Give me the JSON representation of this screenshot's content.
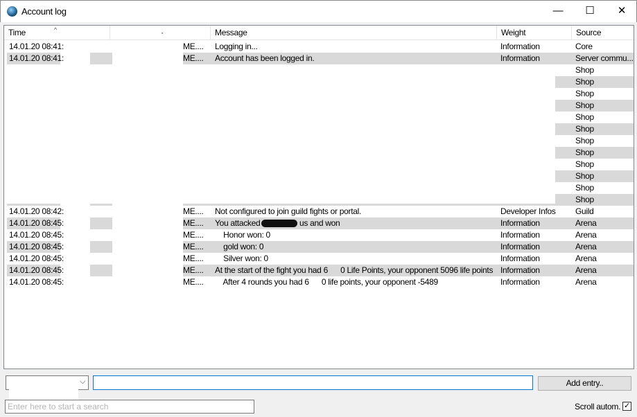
{
  "window": {
    "title": "Account log",
    "minimize": "—",
    "maximize": "☐",
    "close": "✕"
  },
  "columns": {
    "time": "Time",
    "col2": "·",
    "message": "Message",
    "weight": "Weight",
    "source": "Source"
  },
  "rows": [
    {
      "time": "14.01.20 08:41:",
      "c2": "ME....",
      "message": "Logging in...",
      "weight": "Information",
      "source": "Core"
    },
    {
      "time": "14.01.20 08:41:",
      "c2": "ME....",
      "message": "Account has been logged in.",
      "weight": "Information",
      "source": "Server commu..."
    },
    {
      "source": "Shop"
    },
    {
      "source": "Shop"
    },
    {
      "source": "Shop"
    },
    {
      "source": "Shop"
    },
    {
      "source": "Shop"
    },
    {
      "source": "Shop"
    },
    {
      "source": "Shop"
    },
    {
      "source": "Shop"
    },
    {
      "source": "Shop"
    },
    {
      "source": "Shop"
    },
    {
      "source": "Shop"
    },
    {
      "source": "Shop"
    },
    {
      "time": "14.01.20 08:42:",
      "c2": "ME....",
      "message": "Not configured to join guild fights or portal.",
      "weight": "Developer Infos",
      "source": "Guild"
    },
    {
      "time": "14.01.20 08:45:",
      "c2": "ME....",
      "message": "You attacked",
      "message_tail": "us and won",
      "weight": "Information",
      "source": "Arena"
    },
    {
      "time": "14.01.20 08:45:",
      "c2": "ME....",
      "message": "    Honor won: 0",
      "weight": "Information",
      "source": "Arena"
    },
    {
      "time": "14.01.20 08:45:",
      "c2": "ME....",
      "message": "    gold won: 0",
      "weight": "Information",
      "source": "Arena"
    },
    {
      "time": "14.01.20 08:45:",
      "c2": "ME....",
      "message": "    Silver won: 0",
      "weight": "Information",
      "source": "Arena"
    },
    {
      "time": "14.01.20 08:45:",
      "c2": "ME....",
      "message": "At the start of the fight you had 6      0 Life Points, your opponent 5096 life points",
      "weight": "Information",
      "source": "Arena"
    },
    {
      "time": "14.01.20 08:45:",
      "c2": "ME....",
      "message": "    After 4 rounds you had 6      0 life points, your opponent -5489",
      "weight": "Information",
      "source": "Arena"
    }
  ],
  "bottom": {
    "entry_value": "",
    "add_entry": "Add entry..",
    "search_placeholder": "Enter here to start a search",
    "scroll_label": "Scroll autom.",
    "scroll_checked": true,
    "check_mark": "✓"
  }
}
